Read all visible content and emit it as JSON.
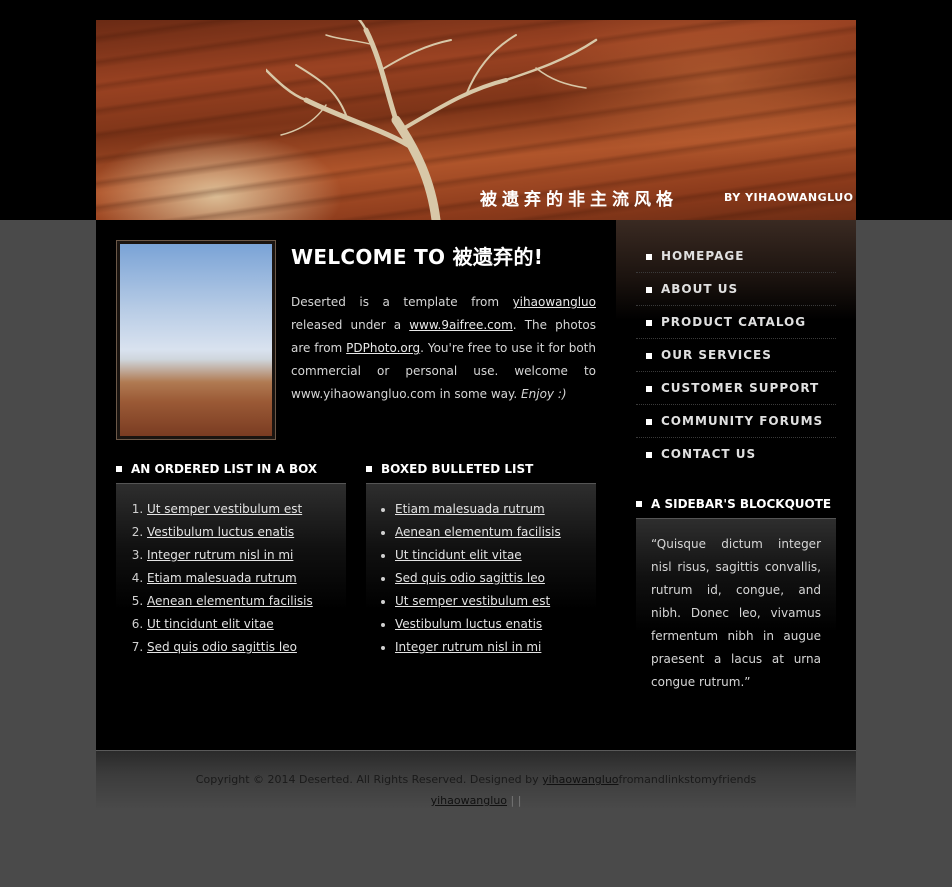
{
  "header": {
    "site_title_cn": "被遗弃的非主流风格",
    "byline": "BY YIHAOWANGLUO"
  },
  "main": {
    "welcome_title": "WELCOME TO 被遗弃的!",
    "intro": {
      "p1": "Deserted is a template from ",
      "link1": "yihaowangluo",
      "p2": " released under a ",
      "link2": "www.9aifree.com",
      "p3": ". The photos are from ",
      "link3": "PDPhoto.org",
      "p4": ". You're free to use it for both commercial or personal use. welcome to www.yihaowangluo.com in some way. ",
      "em": "Enjoy :)"
    },
    "ordered_box": {
      "title": "AN ORDERED LIST IN A BOX",
      "items": [
        "Ut semper vestibulum est",
        "Vestibulum luctus enatis",
        "Integer rutrum nisl in mi",
        "Etiam malesuada rutrum",
        "Aenean elementum facilisis",
        "Ut tincidunt elit vitae",
        "Sed quis odio sagittis leo"
      ]
    },
    "bulleted_box": {
      "title": "BOXED BULLETED LIST",
      "items": [
        "Etiam malesuada rutrum",
        "Aenean elementum facilisis",
        "Ut tincidunt elit vitae",
        "Sed quis odio sagittis leo",
        "Ut semper vestibulum est",
        "Vestibulum luctus enatis",
        "Integer rutrum nisl in mi"
      ]
    }
  },
  "sidebar": {
    "nav": [
      "HOMEPAGE",
      "ABOUT US",
      "PRODUCT CATALOG",
      "OUR SERVICES",
      "CUSTOMER SUPPORT",
      "COMMUNITY FORUMS",
      "CONTACT US"
    ],
    "blockquote_title": "A SIDEBAR'S BLOCKQUOTE",
    "blockquote": "“Quisque dictum integer nisl risus, sagittis convallis, rutrum id, congue, and nibh. Donec leo, vivamus fermentum nibh in augue praesent a lacus at urna congue rutrum.”"
  },
  "footer": {
    "copyright": "Copyright © 2014 Deserted. All Rights Reserved. Designed by ",
    "designer_link": "yihaowangluo",
    "after": "fromandlinkstomyfriends",
    "link2": "yihaowangluo",
    "sep": " | |"
  },
  "colors": {
    "page_bg": "#4a4a4a",
    "content_bg": "#000000",
    "header_rock": "#9a4222"
  }
}
